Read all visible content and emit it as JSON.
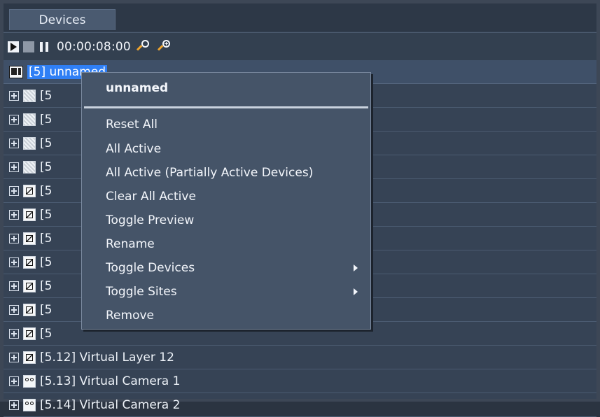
{
  "tabs": [
    "Devices"
  ],
  "toolbar": {
    "time": "00:00:08:00"
  },
  "tree": {
    "root": {
      "label": "[5] unnamed"
    },
    "rows": [
      {
        "label": "[5",
        "icon": "grey"
      },
      {
        "label": "[5",
        "icon": "grey"
      },
      {
        "label": "[5",
        "icon": "grey"
      },
      {
        "label": "[5",
        "icon": "grey"
      },
      {
        "label": "[5",
        "icon": "layer"
      },
      {
        "label": "[5",
        "icon": "layer"
      },
      {
        "label": "[5",
        "icon": "layer"
      },
      {
        "label": "[5",
        "icon": "layer"
      },
      {
        "label": "[5",
        "icon": "layer"
      },
      {
        "label": "[5",
        "icon": "layer"
      },
      {
        "label": "[5",
        "icon": "layer"
      },
      {
        "label": "[5.12] Virtual Layer 12",
        "icon": "layer"
      },
      {
        "label": "[5.13] Virtual Camera 1",
        "icon": "camera"
      },
      {
        "label": "[5.14] Virtual Camera 2",
        "icon": "camera"
      }
    ]
  },
  "menu": {
    "title": "unnamed",
    "items": [
      "Reset All",
      "All Active",
      "All Active (Partially Active Devices)",
      "Clear All Active",
      "Toggle Preview",
      "Rename",
      "Toggle Devices",
      "Toggle Sites",
      "Remove"
    ],
    "submenu_items": [
      "Toggle Devices",
      "Toggle Sites"
    ]
  }
}
